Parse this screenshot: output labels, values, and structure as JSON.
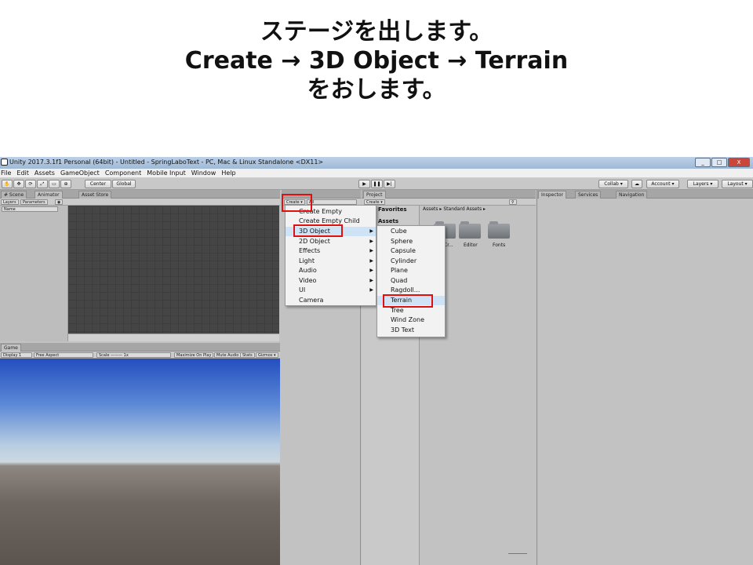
{
  "caption": {
    "line1": "ステージを出します。",
    "line2": "Create → 3D Object → Terrain",
    "line3": "をおします。"
  },
  "window": {
    "title": "Unity 2017.3.1f1 Personal (64bit) - Untitled - SpringLaboText - PC, Mac & Linux Standalone <DX11>",
    "minimize": "_",
    "maximize": "□",
    "close": "X"
  },
  "menubar": [
    "File",
    "Edit",
    "Assets",
    "GameObject",
    "Component",
    "Mobile Input",
    "Window",
    "Help"
  ],
  "toolbar": {
    "center": "Center",
    "global": "Global",
    "play": "▶",
    "pause": "❚❚",
    "step": "▶|",
    "collab": "Collab ▾",
    "cloud": "☁",
    "account": "Account ▾",
    "layers": "Layers ▾",
    "layout": "Layout ▾"
  },
  "left_tabs": {
    "scene": "# Scene",
    "animator": "Animator",
    "asset_store": "Asset Store"
  },
  "animator_tabs": {
    "layers": "Layers",
    "parameters": "Parameters",
    "search_placeholder": "Name"
  },
  "game_tab": {
    "label": "Game",
    "display": "Display 1",
    "aspect": "Free Aspect",
    "scale": "Scale",
    "scale_value": "1x",
    "maximize": "Maximize On Play",
    "mute": "Mute Audio",
    "stats": "Stats",
    "gizmos": "Gizmos ▾"
  },
  "hierarchy": {
    "create": "Create ▾",
    "search_placeholder": "All"
  },
  "project": {
    "tab": "Project",
    "create": "Create ▾",
    "favorites": "Favorites",
    "assets": "Assets",
    "breadcrumb": "Assets ▸ Standard Assets ▸",
    "folders": [
      "Cr...",
      "Editor",
      "Fonts"
    ]
  },
  "inspector": {
    "tab_inspector": "Inspector",
    "tab_services": "Services",
    "tab_navigation": "Navigation"
  },
  "create_menu": [
    "Create Empty",
    "Create Empty Child",
    "3D Object",
    "2D Object",
    "Effects",
    "Light",
    "Audio",
    "Video",
    "UI",
    "Camera"
  ],
  "submenu_3d": [
    "Cube",
    "Sphere",
    "Capsule",
    "Cylinder",
    "Plane",
    "Quad",
    "Ragdoll...",
    "Terrain",
    "Tree",
    "Wind Zone",
    "3D Text"
  ],
  "colors": {
    "highlight_box": "#e01010",
    "selected_item": "#cfe3f7"
  }
}
